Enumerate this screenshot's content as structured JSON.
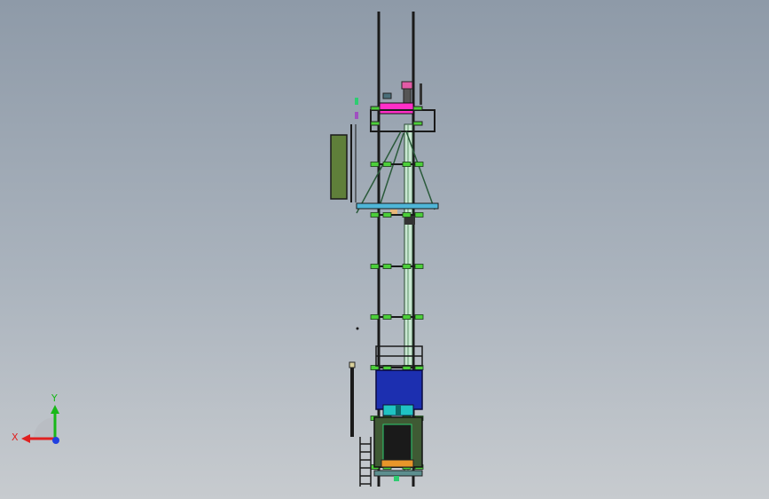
{
  "viewport": {
    "background_top": "#8e9aa8",
    "background_bottom": "#c7cbcf"
  },
  "model": {
    "frame_color": "#1a1a1a",
    "bracket_color": "#4ccf3a",
    "magenta_part_color": "#ff2fc8",
    "cyan_platform_color": "#4fb6d8",
    "green_cabinet_color": "#5f7f3a",
    "blue_cabin_color": "#1c2fb0",
    "orange_part_color": "#e8962a"
  },
  "triad": {
    "x_label": "X",
    "y_label": "Y",
    "x_color": "#e02020",
    "y_color": "#18b818",
    "z_color": "#2040e0"
  }
}
